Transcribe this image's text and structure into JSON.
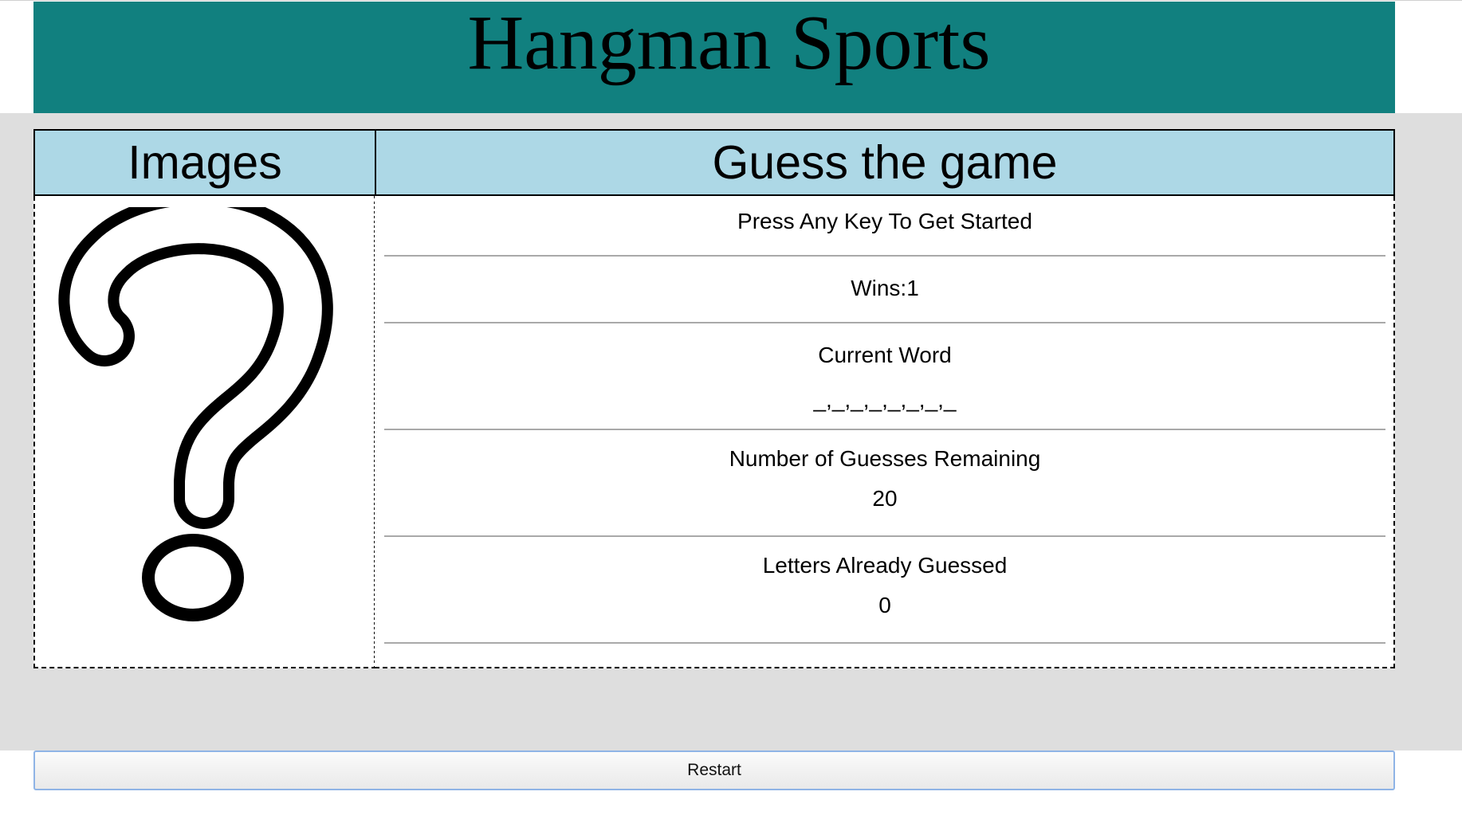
{
  "header": {
    "title": "Hangman Sports",
    "background_color": "#11807f"
  },
  "board": {
    "images_header": "Images",
    "guess_header": "Guess the game",
    "header_color": "#add8e6",
    "image_icon": "question-mark-icon"
  },
  "game": {
    "prompt": "Press Any Key To Get Started",
    "wins_text": "Wins:1",
    "current_word_label": "Current Word",
    "current_word_value": "_,_,_,_,_,_,_,_",
    "guesses_label": "Number of Guesses Remaining",
    "guesses_value": "20",
    "letters_label": "Letters Already Guessed",
    "letters_value": "0"
  },
  "controls": {
    "restart_label": "Restart"
  }
}
